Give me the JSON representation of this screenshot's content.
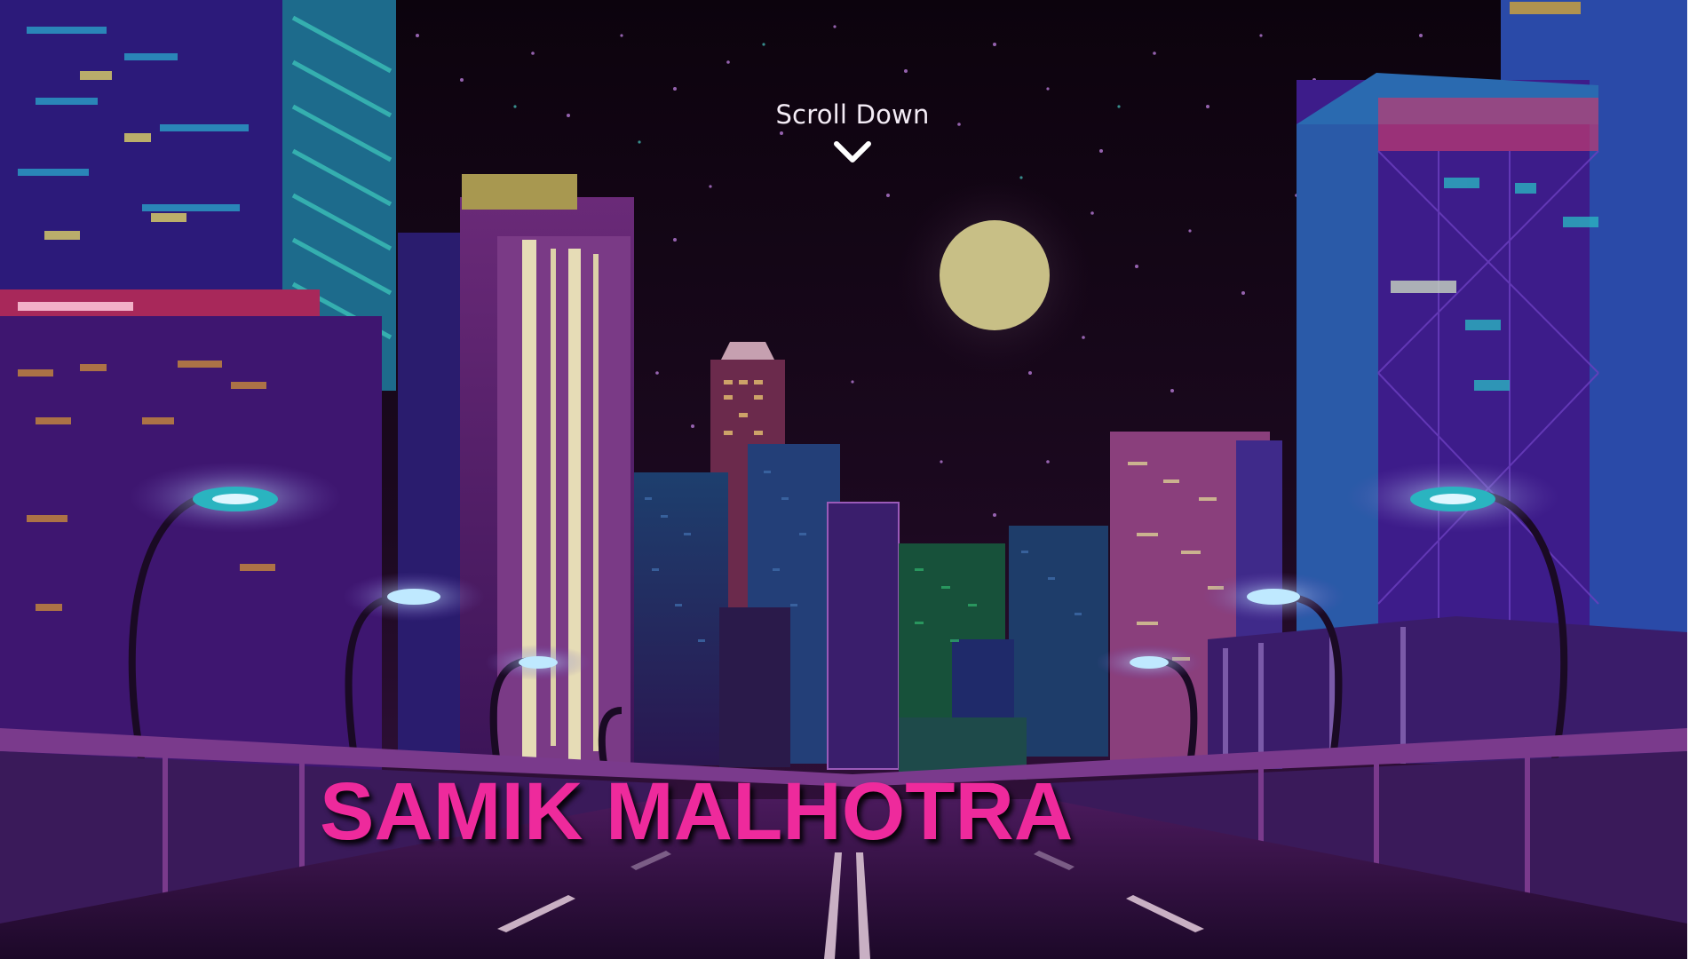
{
  "hero": {
    "scroll_label": "Scroll Down",
    "scroll_icon": "chevron-down-icon",
    "name": "SAMIK MALHOTRA"
  },
  "colors": {
    "name": "#ee2a9c",
    "sky": "#120612",
    "moon": "#c8bf86",
    "neon_purple": "#8a2fc4",
    "neon_teal": "#29b3b1",
    "road": "#2b0f3a"
  }
}
